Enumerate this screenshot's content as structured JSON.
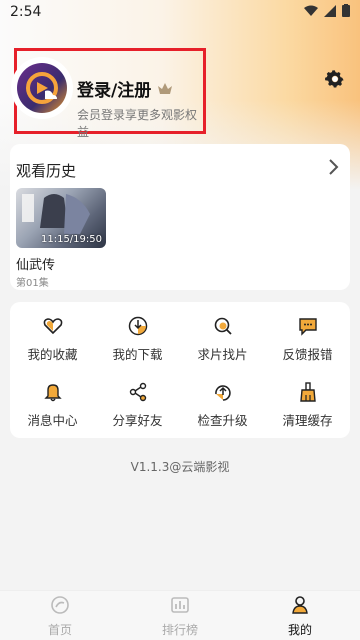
{
  "status": {
    "time": "2:54"
  },
  "profile": {
    "title": "登录/注册",
    "subtitle": "会员登录享更多观影权益"
  },
  "history": {
    "title": "观看历史",
    "item": {
      "name": "仙武传",
      "episode": "第01集",
      "progress_text": "11:15/19:50"
    }
  },
  "grid": {
    "items": [
      {
        "label": "我的收藏",
        "icon": "heart-icon"
      },
      {
        "label": "我的下载",
        "icon": "download-icon"
      },
      {
        "label": "求片找片",
        "icon": "search-film-icon"
      },
      {
        "label": "反馈报错",
        "icon": "feedback-icon"
      },
      {
        "label": "消息中心",
        "icon": "bell-icon"
      },
      {
        "label": "分享好友",
        "icon": "share-icon"
      },
      {
        "label": "检查升级",
        "icon": "upgrade-icon"
      },
      {
        "label": "清理缓存",
        "icon": "broom-icon"
      }
    ]
  },
  "version": "V1.1.3@云端影视",
  "nav": {
    "items": [
      {
        "label": "首页"
      },
      {
        "label": "排行榜"
      },
      {
        "label": "我的"
      }
    ]
  },
  "colors": {
    "accent": "#f2a93a",
    "highlight_border": "#e6202a",
    "arrow": "#e3212b"
  }
}
